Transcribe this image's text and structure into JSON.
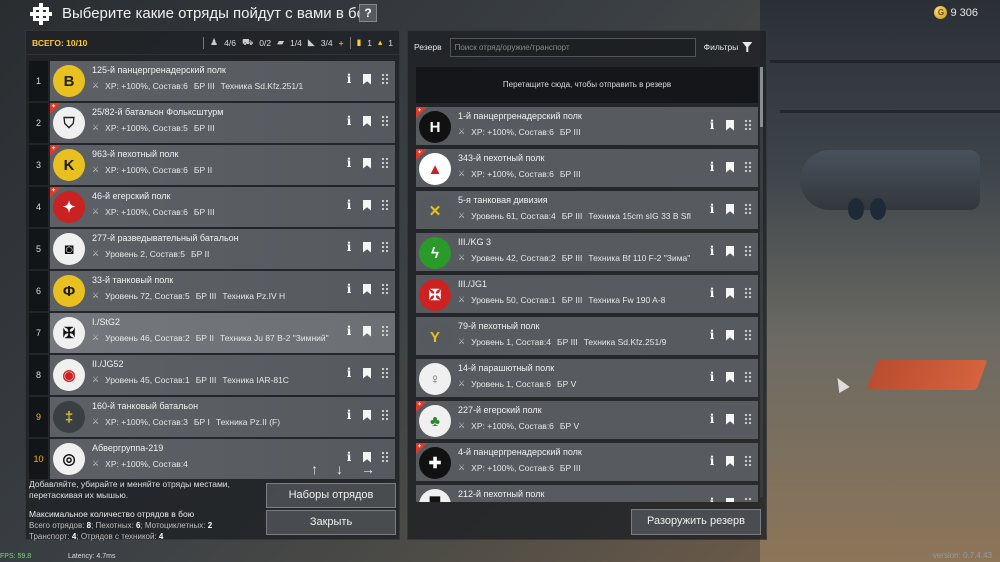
{
  "header": {
    "title": "Выберите какие отряды пойдут с вами в бой",
    "help": "?",
    "gold": "9 306"
  },
  "left": {
    "total": "ВСЕГО: 10/10",
    "stats": [
      "4/6",
      "0/2",
      "1/4",
      "3/4",
      "+",
      "1",
      "1"
    ],
    "squads": [
      {
        "num": "1",
        "gold": false,
        "name": "125-й панцергренадерский полк",
        "info": "XP: +100%, Состав:6",
        "br": "БР III",
        "tech": "Техника Sd.Kfz.251/1",
        "emblem_bg": "#e8c020",
        "emblem_fg": "#222",
        "emblem_glyph": "B",
        "new": false,
        "selected": false
      },
      {
        "num": "2",
        "gold": false,
        "name": "25/82-й батальон Фольксштурм",
        "info": "XP: +100%, Состав:5",
        "br": "БР III",
        "tech": "",
        "emblem_bg": "#f0f0f0",
        "emblem_fg": "#222",
        "emblem_glyph": "⛉",
        "new": true,
        "selected": false
      },
      {
        "num": "3",
        "gold": false,
        "name": "963-й пехотный полк",
        "info": "XP: +100%, Состав:6",
        "br": "БР II",
        "tech": "",
        "emblem_bg": "#e8c020",
        "emblem_fg": "#1a1a1a",
        "emblem_glyph": "K",
        "new": true,
        "selected": false
      },
      {
        "num": "4",
        "gold": false,
        "name": "46-й егерский полк",
        "info": "XP: +100%, Состав:6",
        "br": "БР III",
        "tech": "",
        "emblem_bg": "#c92222",
        "emblem_fg": "#fff",
        "emblem_glyph": "✦",
        "new": true,
        "selected": false
      },
      {
        "num": "5",
        "gold": false,
        "name": "277-й разведывательный батальон",
        "info": "Уровень 2, Состав:5",
        "br": "БР II",
        "tech": "",
        "emblem_bg": "#f0f0f0",
        "emblem_fg": "#111",
        "emblem_glyph": "◙",
        "new": false,
        "selected": false
      },
      {
        "num": "6",
        "gold": false,
        "name": "33-й танковый полк",
        "info": "Уровень 72, Состав:5",
        "br": "БР III",
        "tech": "Техника Pz.IV H",
        "emblem_bg": "#e8c020",
        "emblem_fg": "#1a1a1a",
        "emblem_glyph": "Φ",
        "new": false,
        "selected": false
      },
      {
        "num": "7",
        "gold": false,
        "name": "I./StG2",
        "info": "Уровень 46, Состав:2",
        "br": "БР II",
        "tech": "Техника Ju 87 B-2 \"Зимний\"",
        "emblem_bg": "#f0f0f0",
        "emblem_fg": "#111",
        "emblem_glyph": "✠",
        "new": false,
        "selected": true
      },
      {
        "num": "8",
        "gold": false,
        "name": "II./JG52",
        "info": "Уровень 45, Состав:1",
        "br": "БР III",
        "tech": "Техника IAR-81C",
        "emblem_bg": "#f0f0f0",
        "emblem_fg": "#c22",
        "emblem_glyph": "◉",
        "new": false,
        "selected": false
      },
      {
        "num": "9",
        "gold": true,
        "name": "160-й танковый батальон",
        "info": "XP: +100%, Состав:3",
        "br": "БР I",
        "tech": "Техника Pz.II (F)",
        "emblem_bg": "#3a3f44",
        "emblem_fg": "#e8c020",
        "emblem_glyph": "‡",
        "new": false,
        "selected": false
      },
      {
        "num": "10",
        "gold": true,
        "name": "Абвергруппа-219",
        "info": "XP: +100%, Состав:4",
        "br": "",
        "tech": "",
        "emblem_bg": "#f0f0f0",
        "emblem_fg": "#111",
        "emblem_glyph": "◎",
        "new": false,
        "selected": false
      }
    ],
    "footer": {
      "hint": "Добавляйте, убирайте и меняйте отряды местами, перетаскивая их мышью.",
      "max_title": "Максимальное количество отрядов в бою",
      "line1_label": "Всего отрядов: ",
      "line1_val": "8",
      "line1b_label": "; Пехотных: ",
      "line1b_val": "6",
      "line1c_label": "; Мотоциклетных: ",
      "line1c_val": "2",
      "line2_label": "Транспорт: ",
      "line2_val": "4",
      "line2b_label": "; Отрядов с техникой: ",
      "line2b_val": "4"
    },
    "presets_label": "Наборы отрядов",
    "close_label": "Закрыть"
  },
  "right": {
    "reserve_label": "Резерв",
    "search_placeholder": "Поиск отряд/оружие/транспорт",
    "filters_label": "Фильтры",
    "dropzone": "Перетащите сюда, чтобы отправить в резерв",
    "squads": [
      {
        "name": "1-й панцергренадерский полк",
        "info": "XP: +100%, Состав:6",
        "br": "БР III",
        "tech": "",
        "emblem_bg": "#111",
        "emblem_fg": "#fff",
        "emblem_glyph": "H",
        "new": true
      },
      {
        "name": "343-й пехотный полк",
        "info": "XP: +100%, Состав:6",
        "br": "БР III",
        "tech": "",
        "emblem_bg": "#fff",
        "emblem_fg": "#c22",
        "emblem_glyph": "▲",
        "new": true
      },
      {
        "name": "5-я танковая дивизия",
        "info": "Уровень 61, Состав:4",
        "br": "БР III",
        "tech": "Техника 15cm sIG 33 B Sfl",
        "emblem_bg": "#555a5f",
        "emblem_fg": "#e8c020",
        "emblem_glyph": "✕",
        "new": false
      },
      {
        "name": "III./KG 3",
        "info": "Уровень 42, Состав:2",
        "br": "БР III",
        "tech": "Техника Bf 110 F-2 \"Зима\"",
        "emblem_bg": "#2a9a2a",
        "emblem_fg": "#fff",
        "emblem_glyph": "ϟ",
        "new": false
      },
      {
        "name": "III./JG1",
        "info": "Уровень 50, Состав:1",
        "br": "БР III",
        "tech": "Техника Fw 190 A-8",
        "emblem_bg": "#c22",
        "emblem_fg": "#fff",
        "emblem_glyph": "✠",
        "new": false
      },
      {
        "name": "79-й пехотный полк",
        "info": "Уровень 1, Состав:4",
        "br": "БР III",
        "tech": "Техника Sd.Kfz.251/9",
        "emblem_bg": "#555a5f",
        "emblem_fg": "#e8c020",
        "emblem_glyph": "Y",
        "new": false
      },
      {
        "name": "14-й парашютный полк",
        "info": "Уровень 1, Состав:6",
        "br": "БР V",
        "tech": "",
        "emblem_bg": "#f0f0f0",
        "emblem_fg": "#666",
        "emblem_glyph": "♀",
        "new": false
      },
      {
        "name": "227-й егерский полк",
        "info": "XP: +100%, Состав:6",
        "br": "БР V",
        "tech": "",
        "emblem_bg": "#f0f0f0",
        "emblem_fg": "#2a8a2a",
        "emblem_glyph": "♣",
        "new": true
      },
      {
        "name": "4-й панцергренадерский полк",
        "info": "XP: +100%, Состав:6",
        "br": "БР III",
        "tech": "",
        "emblem_bg": "#111",
        "emblem_fg": "#fff",
        "emblem_glyph": "✚",
        "new": true
      },
      {
        "name": "212-й пехотный полк",
        "info": "",
        "br": "",
        "tech": "",
        "emblem_bg": "#f0f0f0",
        "emblem_fg": "#111",
        "emblem_glyph": "▀",
        "new": false
      }
    ],
    "disarm_label": "Разоружить резерв"
  },
  "footer": {
    "fps": "FPS: 59.8",
    "latency": "Latency: 4.7ms",
    "version": "version: 0.7.4.43"
  }
}
